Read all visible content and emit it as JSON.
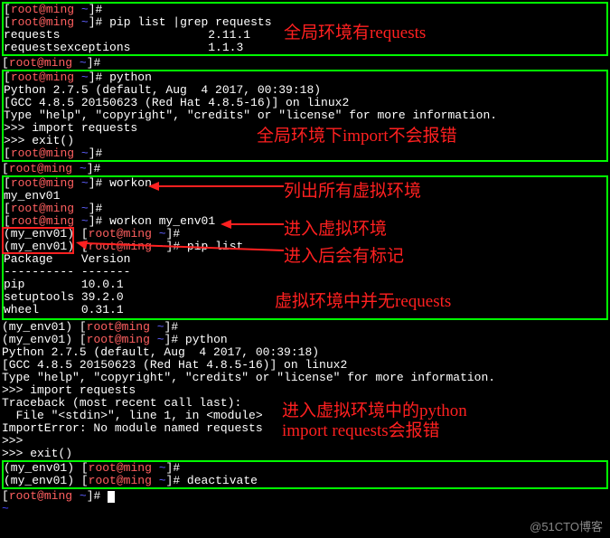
{
  "prompt": {
    "root": "root",
    "at": "@",
    "host": "ming",
    "path": "~",
    "end": "]#"
  },
  "env_tag": "(my_env01)",
  "box1": {
    "cmd": " pip list |grep requests",
    "row1": "requests                     2.11.1",
    "row2": "requestsexceptions           1.1.3"
  },
  "box2": {
    "cmd1": " python",
    "l1": "Python 2.7.5 (default, Aug  4 2017, 00:39:18)",
    "l2": "[GCC 4.8.5 20150623 (Red Hat 4.8.5-16)] on linux2",
    "l3": "Type \"help\", \"copyright\", \"credits\" or \"license\" for more information.",
    "l4": ">>> import requests",
    "l5": ">>> exit()"
  },
  "box3": {
    "cmd1": " workon",
    "out1": "my_env01",
    "cmd2": " workon my_env01",
    "cmd3": " pip list",
    "hdr": "Package    Version",
    "div": "---------- -------",
    "p1": "pip        10.0.1",
    "p2": "setuptools 39.2.0",
    "p3": "wheel      0.31.1"
  },
  "block4": {
    "cmd1": " python",
    "l1": "Python 2.7.5 (default, Aug  4 2017, 00:39:18)",
    "l2": "[GCC 4.8.5 20150623 (Red Hat 4.8.5-16)] on linux2",
    "l3": "Type \"help\", \"copyright\", \"credits\" or \"license\" for more information.",
    "l4": ">>> import requests",
    "l5": "Traceback (most recent call last):",
    "l6": "  File \"<stdin>\", line 1, in <module>",
    "l7": "ImportError: No module named requests",
    "l8": ">>>",
    "l9": ">>> exit()"
  },
  "box5": {
    "cmd1": " deactivate"
  },
  "anno": {
    "a1": "全局环境有requests",
    "a2": "全局环境下import不会报错",
    "a3": "列出所有虚拟环境",
    "a4": "进入虚拟环境",
    "a5": "进入后会有标记",
    "a6": "虚拟环境中并无requests",
    "a7": "进入虚拟环境中的python",
    "a8": "import requests会报错"
  },
  "watermark": "@51CTO博客"
}
